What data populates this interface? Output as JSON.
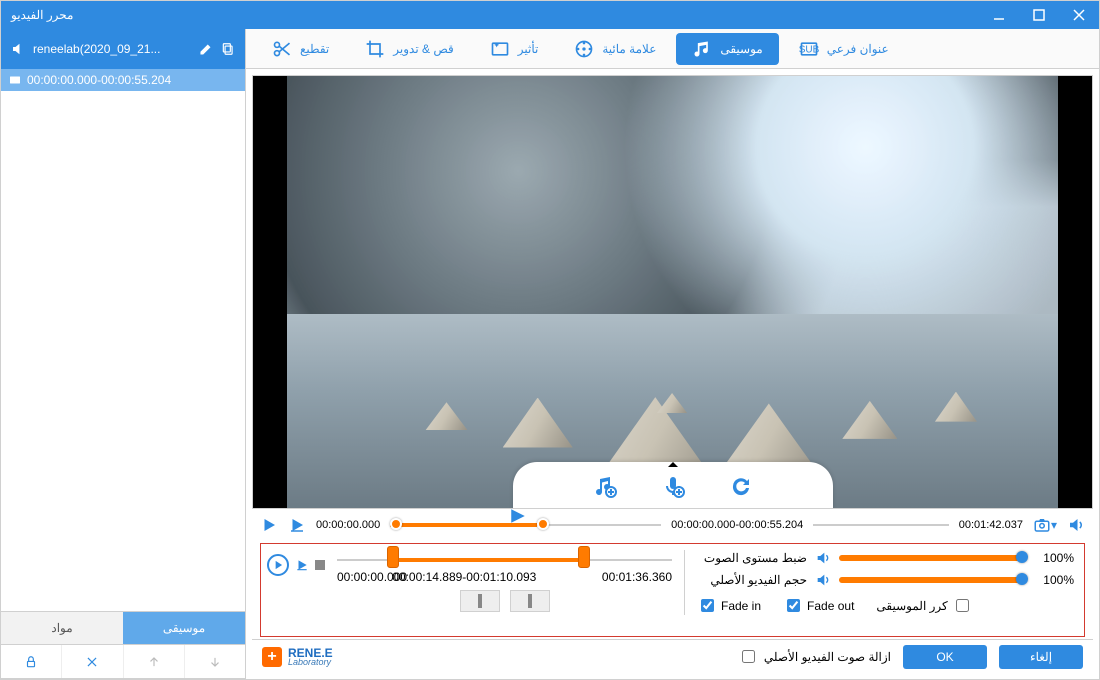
{
  "window": {
    "title": "محرر الفيديو"
  },
  "sidebar": {
    "file_name": "reneelab(2020_09_21...",
    "clip_range": "00:00:00.000-00:00:55.204",
    "tabs": {
      "materials": "مواد",
      "music": "موسيقى"
    }
  },
  "toolbar": {
    "cut": "تقطيع",
    "crop_rotate": "قص & تدوير",
    "effect": "تأثير",
    "watermark": "علامة مائية",
    "music": "موسيقى",
    "subtitle": "عنوان فرعي"
  },
  "preview_timeline": {
    "start": "00:00:00.000",
    "segment": "00:00:00.000-00:00:55.204",
    "total": "00:01:42.037"
  },
  "music_track": {
    "start": "00:00:00.000",
    "segment": "00:00:14.889-00:01:10.093",
    "total": "00:01:36.360"
  },
  "audio_panel": {
    "volume_label": "ضبط مستوى الصوت",
    "original_label": "حجم الفيديو الأصلي",
    "volume_value": "100%",
    "original_value": "100%",
    "fade_in": "Fade in",
    "fade_out": "Fade out",
    "repeat_music": "كرر الموسيقى"
  },
  "footer": {
    "remove_original_audio": "ازالة صوت الفيديو الأصلي",
    "ok": "OK",
    "cancel": "إلغاء",
    "brand": "RENE.E",
    "brand_sub": "Laboratory"
  }
}
